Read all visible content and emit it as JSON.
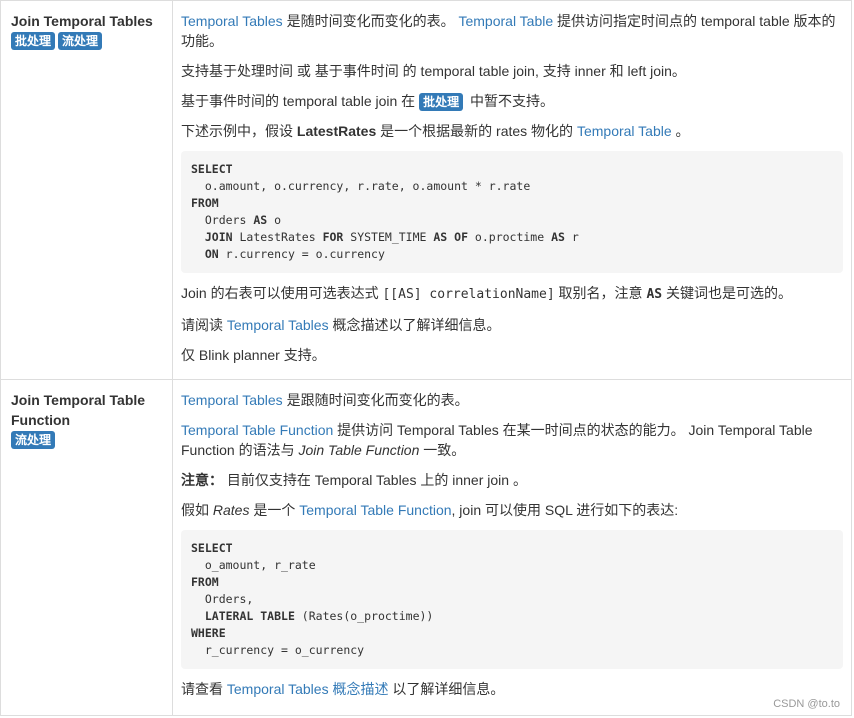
{
  "row1": {
    "title": "Join Temporal Tables",
    "badges": [
      "批处理",
      "流处理"
    ],
    "p1": {
      "link1": "Temporal Tables",
      "t1": " 是随时间变化而变化的表。 ",
      "link2": "Temporal Table",
      "t2": " 提供访问指定时间点的 temporal table 版本的功能。"
    },
    "p2": "支持基于处理时间 或 基于事件时间 的 temporal table join, 支持 inner 和 left join。",
    "p3": {
      "t1": "基于事件时间的 temporal table join 在 ",
      "badge": "批处理",
      "t2": " 中暂不支持。"
    },
    "p4": {
      "t1": "下述示例中，假设 ",
      "bold": "LatestRates",
      "t2": " 是一个根据最新的 rates 物化的 ",
      "link": "Temporal Table",
      "t3": " 。"
    },
    "code": [
      {
        "kw": "SELECT",
        "rest": ""
      },
      {
        "kw": "",
        "rest": "  o.amount, o.currency, r.rate, o.amount * r.rate"
      },
      {
        "kw": "FROM",
        "rest": ""
      },
      {
        "kw": "",
        "rest": "  Orders AS o",
        "inline": [
          [
            "  Orders ",
            false
          ],
          [
            "AS",
            true
          ],
          [
            " o",
            false
          ]
        ]
      },
      {
        "inline": [
          [
            "  ",
            false
          ],
          [
            "JOIN",
            true
          ],
          [
            " LatestRates ",
            false
          ],
          [
            "FOR",
            true
          ],
          [
            " SYSTEM_TIME ",
            false
          ],
          [
            "AS OF",
            true
          ],
          [
            " o.proctime ",
            false
          ],
          [
            "AS",
            true
          ],
          [
            " r",
            false
          ]
        ]
      },
      {
        "inline": [
          [
            "  ",
            false
          ],
          [
            "ON",
            true
          ],
          [
            " r.currency = o.currency",
            false
          ]
        ]
      }
    ],
    "p5": {
      "t1": "Join 的右表可以使用可选表达式 ",
      "code": "[[AS] correlationName]",
      "t2": " 取别名，注意 ",
      "kw": "AS",
      "t3": " 关键词也是可选的。"
    },
    "p6": {
      "t1": "请阅读 ",
      "link": "Temporal Tables",
      "t2": " 概念描述以了解详细信息。"
    },
    "p7": "仅 Blink planner 支持。"
  },
  "row2": {
    "title": "Join Temporal Table Function",
    "badges": [
      "流处理"
    ],
    "p1": {
      "link": "Temporal Tables",
      "t1": " 是跟随时间变化而变化的表。"
    },
    "p2": {
      "link": "Temporal Table Function",
      "t1": " 提供访问 Temporal Tables 在某一时间点的状态的能力。 Join Temporal Table Function 的语法与 ",
      "em": "Join Table Function",
      "t2": " 一致。"
    },
    "p3": {
      "bold": "注意：",
      "t1": " 目前仅支持在 Temporal Tables 上的 inner join 。"
    },
    "p4": {
      "t1": "假如 ",
      "em": "Rates",
      "t2": " 是一个 ",
      "link": "Temporal Table Function",
      "t3": ", join 可以使用 SQL 进行如下的表达:"
    },
    "code": [
      {
        "inline": [
          [
            "SELECT",
            true
          ]
        ]
      },
      {
        "inline": [
          [
            "  o_amount, r_rate",
            false
          ]
        ]
      },
      {
        "inline": [
          [
            "FROM",
            true
          ]
        ]
      },
      {
        "inline": [
          [
            "  Orders,",
            false
          ]
        ]
      },
      {
        "inline": [
          [
            "  ",
            false
          ],
          [
            "LATERAL TABLE",
            true
          ],
          [
            " (Rates(o_proctime))",
            false
          ]
        ]
      },
      {
        "inline": [
          [
            "WHERE",
            true
          ]
        ]
      },
      {
        "inline": [
          [
            "  r_currency = o_currency",
            false
          ]
        ]
      }
    ],
    "p5": {
      "t1": "请查看 ",
      "link": "Temporal Tables 概念描述",
      "t2": " 以了解详细信息。"
    }
  },
  "watermark": "CSDN @to.to"
}
